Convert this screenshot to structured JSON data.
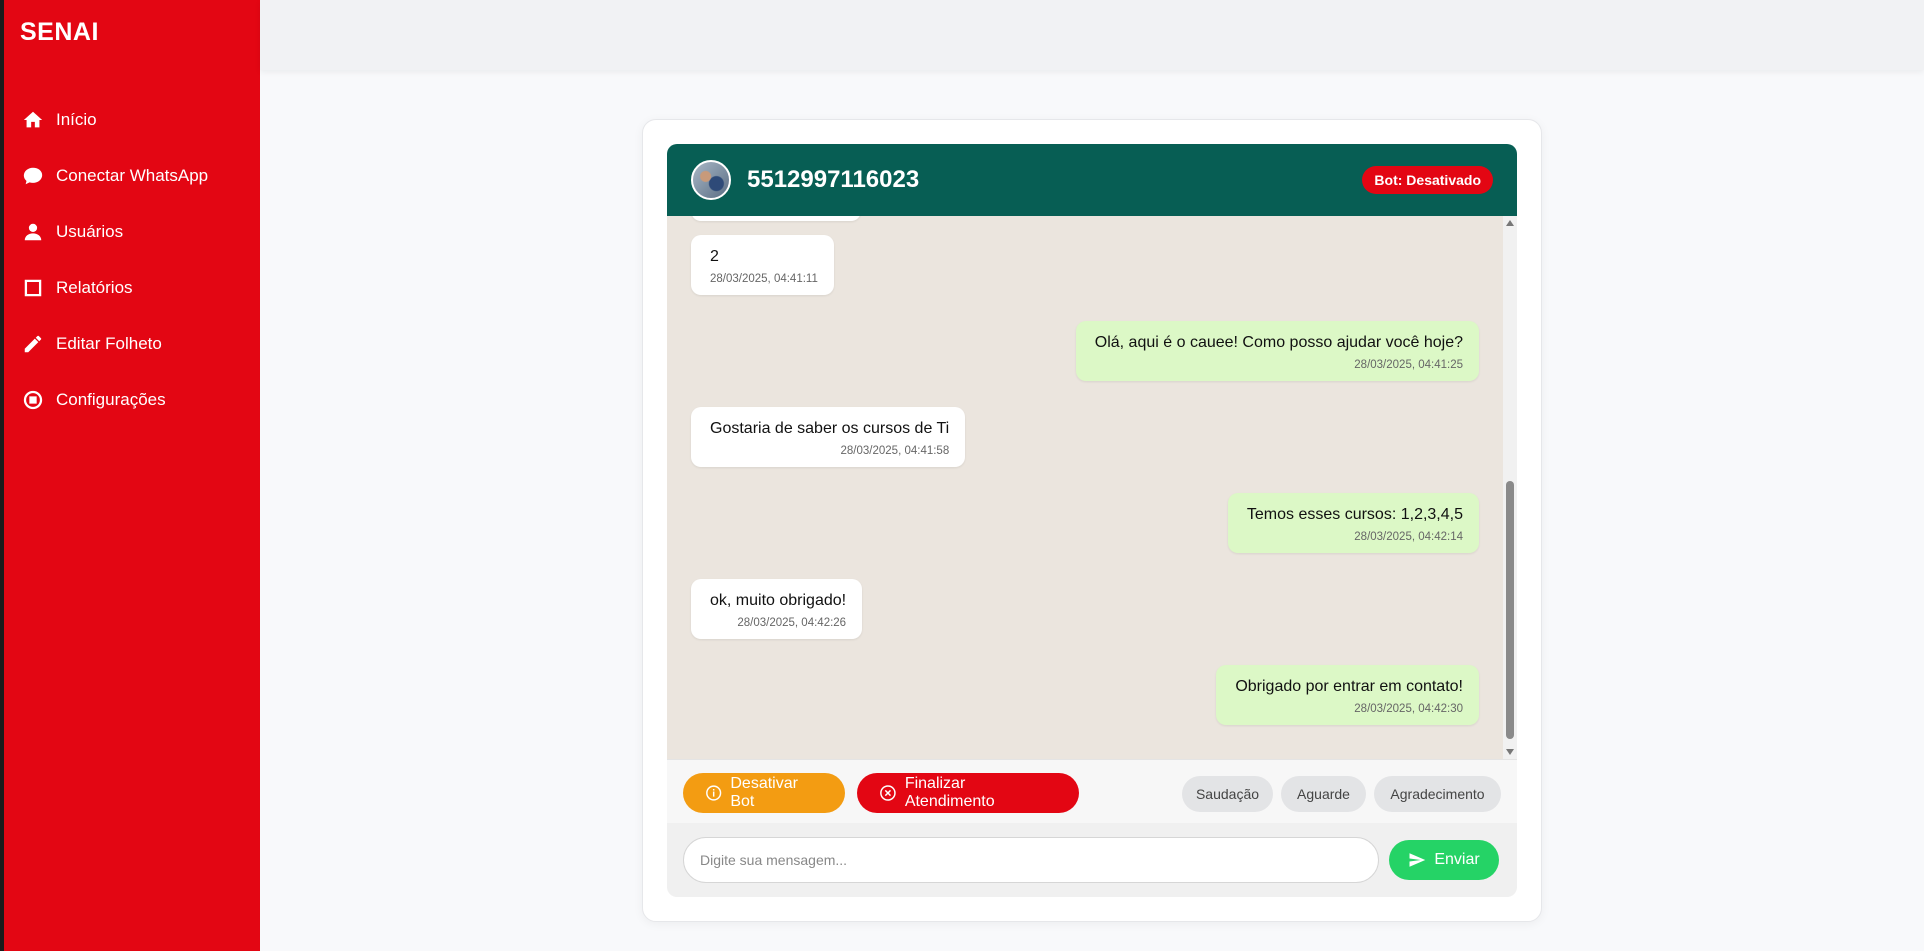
{
  "sidebar": {
    "brand": "SENAI",
    "items": [
      {
        "label": "Início",
        "icon": "home-icon"
      },
      {
        "label": "Conectar WhatsApp",
        "icon": "chat-bubble-icon"
      },
      {
        "label": "Usuários",
        "icon": "user-icon"
      },
      {
        "label": "Relatórios",
        "icon": "report-icon"
      },
      {
        "label": "Editar Folheto",
        "icon": "pencil-icon"
      },
      {
        "label": "Configurações",
        "icon": "settings-icon"
      }
    ]
  },
  "chat": {
    "contact_number": "5512997116023",
    "bot_status": "Bot: Desativado",
    "messages": [
      {
        "direction": "in",
        "text": "2",
        "time": "28/03/2025, 04:41:11"
      },
      {
        "direction": "out",
        "text": "Olá, aqui é o cauee! Como posso ajudar você hoje?",
        "time": "28/03/2025, 04:41:25"
      },
      {
        "direction": "in",
        "text": "Gostaria de saber os cursos de Ti",
        "time": "28/03/2025, 04:41:58"
      },
      {
        "direction": "out",
        "text": "Temos esses cursos: 1,2,3,4,5",
        "time": "28/03/2025, 04:42:14"
      },
      {
        "direction": "in",
        "text": "ok, muito obrigado!",
        "time": "28/03/2025, 04:42:26"
      },
      {
        "direction": "out",
        "text": "Obrigado por entrar em contato!",
        "time": "28/03/2025, 04:42:30"
      }
    ]
  },
  "actions": {
    "deactivate_bot": "Desativar Bot",
    "end_service": "Finalizar Atendimento",
    "quick_replies": [
      "Saudação",
      "Aguarde",
      "Agradecimento"
    ]
  },
  "composer": {
    "placeholder": "Digite sua mensagem...",
    "send_label": "Enviar"
  },
  "colors": {
    "brand_red": "#e30613",
    "header_green": "#075e54",
    "outgoing_bubble": "#dcf8c6",
    "chat_background": "#ebe5de",
    "send_green": "#25d366",
    "warning_orange": "#f39c12"
  }
}
